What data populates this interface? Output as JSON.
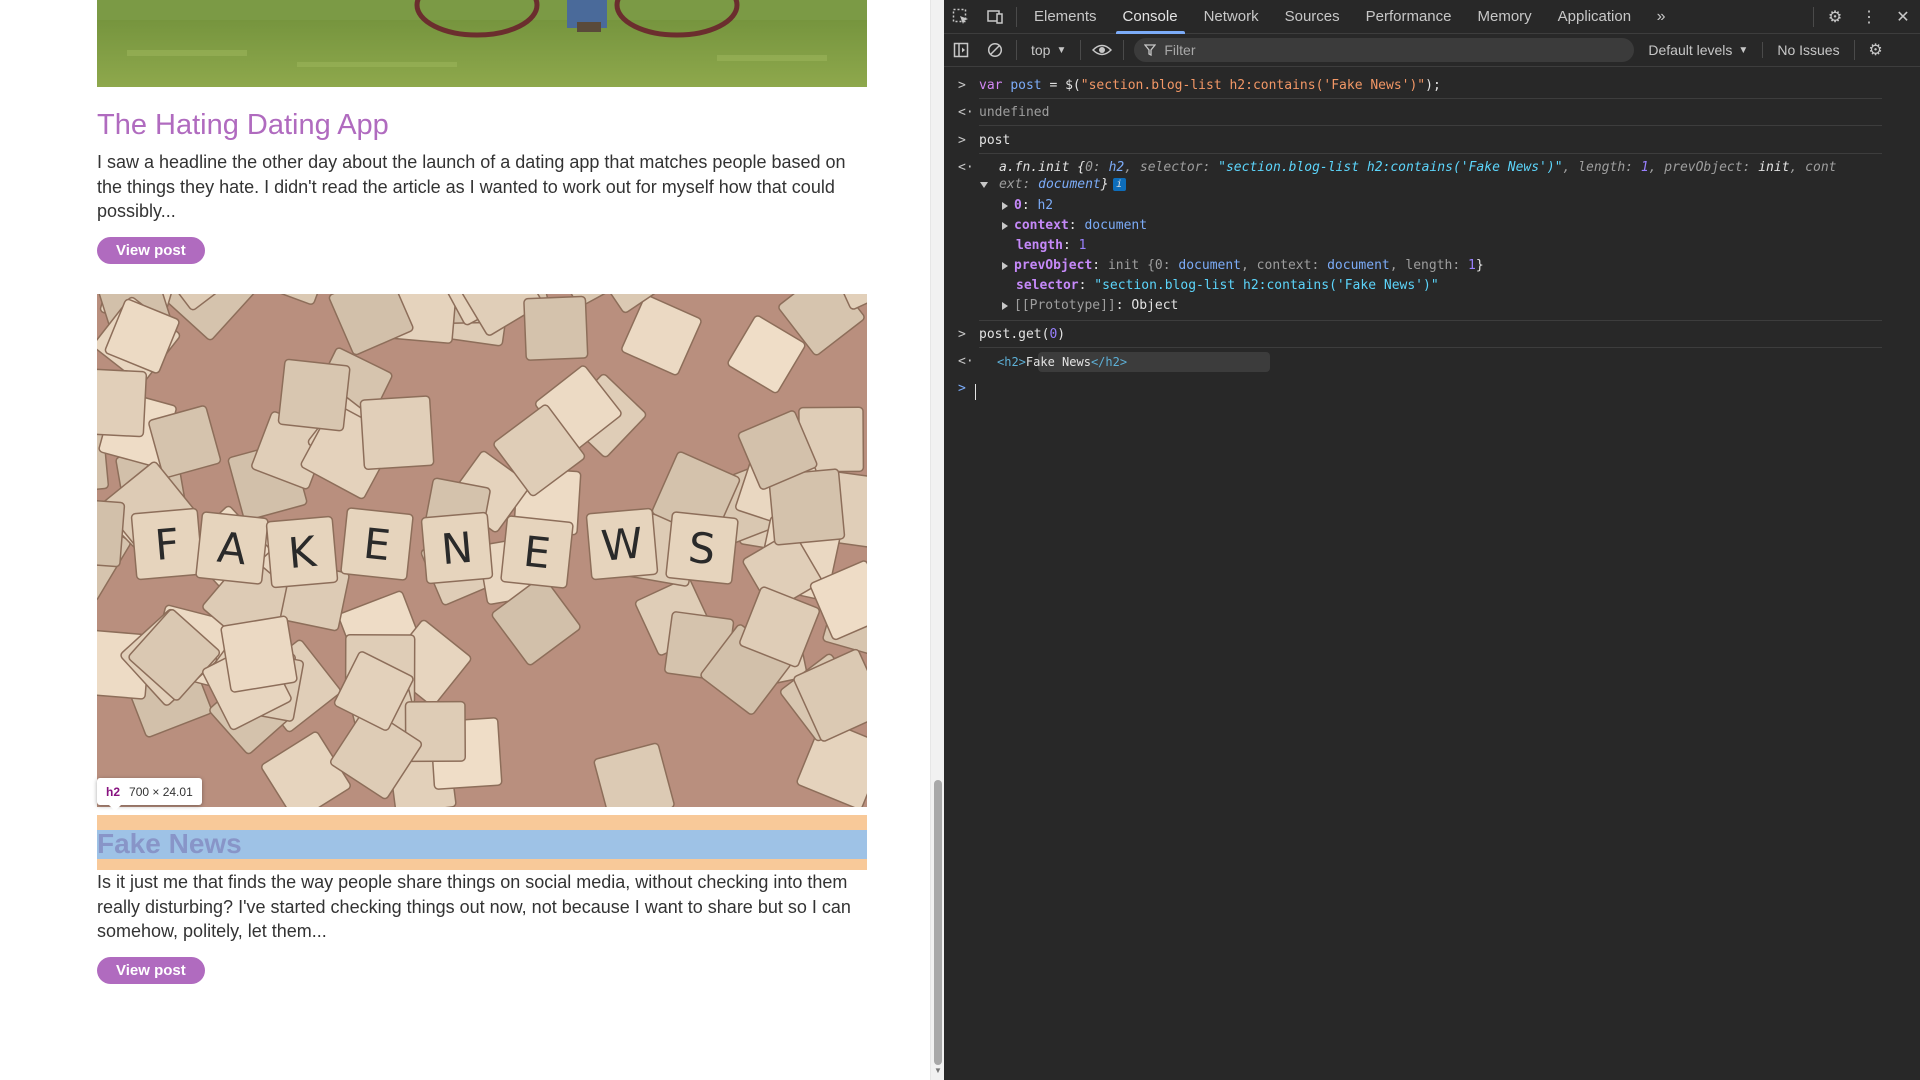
{
  "page": {
    "post1": {
      "title": "The Hating Dating App",
      "excerpt": "I saw a headline the other day about the launch of a dating app that matches people based on the things they hate. I didn't read the article as I wanted to work out for myself how that could possibly...",
      "button": "View post"
    },
    "post2": {
      "title": "Fake News",
      "excerpt": "Is it just me that finds the way people share things on social media, without checking into them really disturbing? I've started checking things out now, not because I want to share but so I can somehow, politely, let them...",
      "button": "View post",
      "image_letters": [
        "F",
        "A",
        "K",
        "E",
        "N",
        "E",
        "W",
        "S"
      ]
    },
    "tooltip": {
      "tag": "h2",
      "dims": "700 × 24.01"
    }
  },
  "devtools": {
    "tabs": [
      "Elements",
      "Console",
      "Network",
      "Sources",
      "Performance",
      "Memory",
      "Application"
    ],
    "active_tab": "Console",
    "context": "top",
    "filter_placeholder": "Filter",
    "levels": "Default levels",
    "issues": "No Issues",
    "console": {
      "l1_kw": "var",
      "l1_var": "post",
      "l1_mid": " = $(",
      "l1_str": "\"section.blog-list h2:contains('Fake News')\"",
      "l1_end": ");",
      "l2": "undefined",
      "l3": "post",
      "l4_a": "a.fn.init {",
      "l4_b": "0: ",
      "l4_c": "h2",
      "l4_d": ", selector: ",
      "l4_e": "\"section.blog-list h2:contains('Fake News')\"",
      "l4_f": ", length: ",
      "l4_g": "1",
      "l4_h": ", prevObject: ",
      "l4_i": "init",
      "l4_j": ", cont",
      "l5_a": "ext: ",
      "l5_b": "document",
      "l5_c": "}",
      "info": "i",
      "p0_k": "0",
      "p0_v": "h2",
      "p1_k": "context",
      "p1_v": "document",
      "p2_k": "length",
      "p2_v": "1",
      "p3_k": "prevObject",
      "p3_a": "init {",
      "p3_b": "0: ",
      "p3_c": "document",
      "p3_d": ", context: ",
      "p3_e": "document",
      "p3_f": ", length: ",
      "p3_g": "1",
      "p3_h": "}",
      "p4_k": "selector",
      "p4_v": "\"section.blog-list h2:contains('Fake News')\"",
      "p5_k": "[[Prototype]]",
      "p5_v": "Object",
      "l6_a": "post",
      "l6_b": ".get(",
      "l6_c": "0",
      "l6_d": ")",
      "l7_open": "<h2>",
      "l7_text": "Fake News",
      "l7_close": "</h2>"
    }
  }
}
